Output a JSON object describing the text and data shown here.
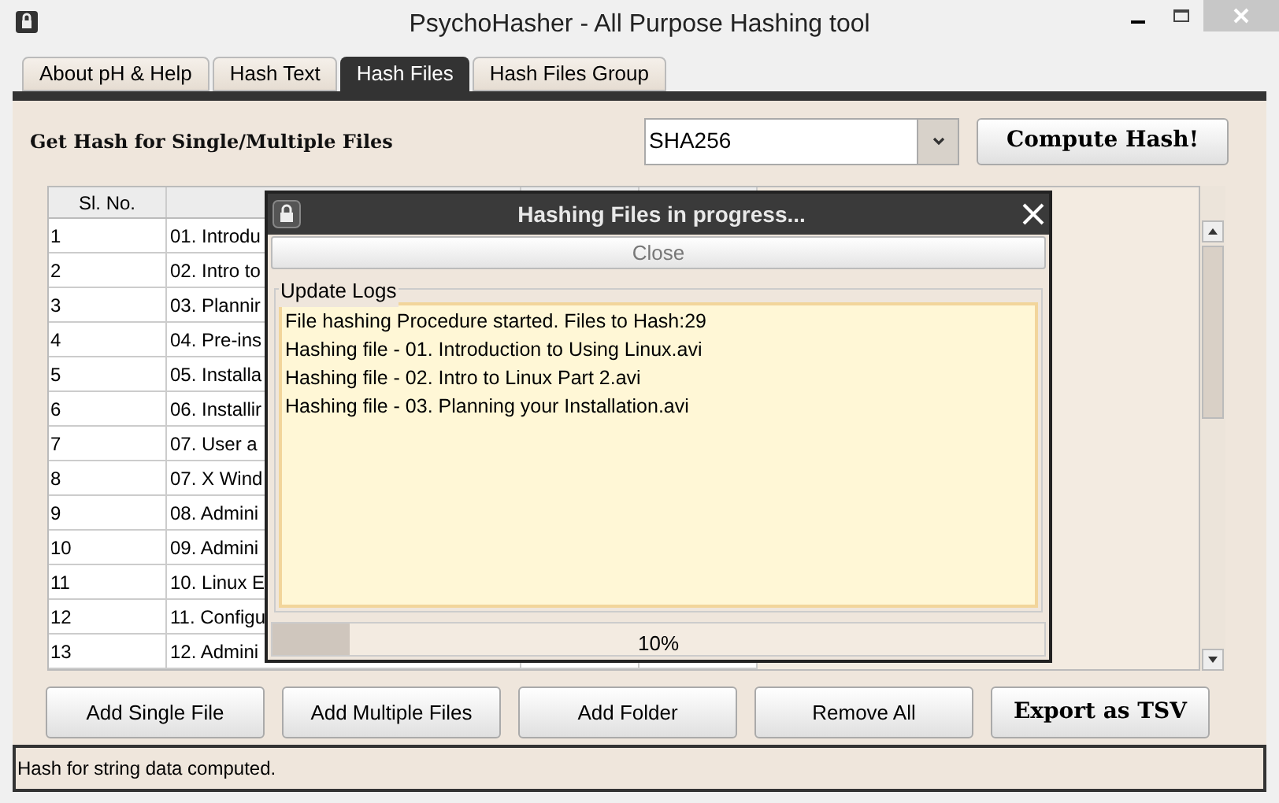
{
  "window": {
    "title": "PsychoHasher - All Purpose Hashing tool"
  },
  "tabs": [
    {
      "label": "About pH & Help",
      "selected": false
    },
    {
      "label": "Hash Text",
      "selected": false
    },
    {
      "label": "Hash Files",
      "selected": true
    },
    {
      "label": "Hash Files Group",
      "selected": false
    }
  ],
  "heading": "Get Hash for Single/Multiple Files",
  "algorithm": {
    "value": "SHA256"
  },
  "compute_button": "Compute Hash!",
  "table": {
    "columns": [
      "Sl. No."
    ],
    "rows": [
      {
        "sl": "1",
        "name": "01. Introdu"
      },
      {
        "sl": "2",
        "name": "02. Intro to"
      },
      {
        "sl": "3",
        "name": "03. Plannir"
      },
      {
        "sl": "4",
        "name": "04. Pre-ins"
      },
      {
        "sl": "5",
        "name": "05. Installa"
      },
      {
        "sl": "6",
        "name": "06. Installir"
      },
      {
        "sl": "7",
        "name": "07. User a"
      },
      {
        "sl": "8",
        "name": "07. X Wind"
      },
      {
        "sl": "9",
        "name": "08. Admini"
      },
      {
        "sl": "10",
        "name": "09. Admini"
      },
      {
        "sl": "11",
        "name": "10. Linux E"
      },
      {
        "sl": "12",
        "name": "11. Configu"
      },
      {
        "sl": "13",
        "name": "12. Admini"
      }
    ]
  },
  "dialog": {
    "title": "Hashing Files in progress...",
    "close_button": "Close",
    "logs_label": "Update Logs",
    "log_lines": [
      "File hashing Procedure started. Files to Hash:29",
      "Hashing file - 01. Introduction to Using Linux.avi",
      "Hashing file - 02. Intro to Linux Part 2.avi",
      "Hashing file - 03. Planning your Installation.avi"
    ],
    "progress": {
      "level": 0.1,
      "reading": "10%"
    }
  },
  "buttons": [
    {
      "label": "Add Single File",
      "kind": "plain"
    },
    {
      "label": "Add Multiple Files",
      "kind": "plain"
    },
    {
      "label": "Add Folder",
      "kind": "plain"
    },
    {
      "label": "Remove All",
      "kind": "plain"
    },
    {
      "label": "Export as TSV",
      "kind": "bold"
    }
  ],
  "status_bar": "Hash for string data computed."
}
